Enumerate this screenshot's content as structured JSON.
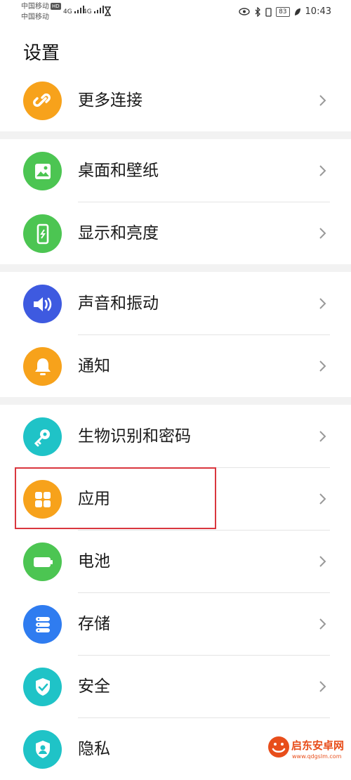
{
  "status_bar": {
    "carrier1": "中国移动",
    "carrier1_badge": "HD",
    "carrier2": "中国移动",
    "signal1": "4G",
    "signal2": "4G",
    "battery": "83",
    "time": "10:43",
    "icons": [
      "eye-icon",
      "bluetooth-icon",
      "vibrate-icon",
      "battery-icon",
      "leaf-icon",
      "hourglass-icon"
    ]
  },
  "page": {
    "title": "设置"
  },
  "settings": {
    "items": [
      {
        "label": "更多连接",
        "icon": "link-icon",
        "color": "#f7a21b"
      },
      {
        "label": "桌面和壁纸",
        "icon": "image-icon",
        "color": "#4cc552"
      },
      {
        "label": "显示和亮度",
        "icon": "display-icon",
        "color": "#4cc552"
      },
      {
        "label": "声音和振动",
        "icon": "speaker-icon",
        "color": "#3e5ae0"
      },
      {
        "label": "通知",
        "icon": "bell-icon",
        "color": "#f7a21b"
      },
      {
        "label": "生物识别和密码",
        "icon": "key-icon",
        "color": "#1fc3c7"
      },
      {
        "label": "应用",
        "icon": "apps-icon",
        "color": "#f7a21b",
        "highlighted": true
      },
      {
        "label": "电池",
        "icon": "battery-icon",
        "color": "#4cc552"
      },
      {
        "label": "存储",
        "icon": "storage-icon",
        "color": "#2f7cf0"
      },
      {
        "label": "安全",
        "icon": "shield-icon",
        "color": "#1fc3c7"
      },
      {
        "label": "隐私",
        "icon": "privacy-icon",
        "color": "#1fc3c7"
      }
    ]
  },
  "watermark": {
    "text": "启东安卓网",
    "url": "www.qdgslm.com",
    "color": "#e84e1b"
  }
}
